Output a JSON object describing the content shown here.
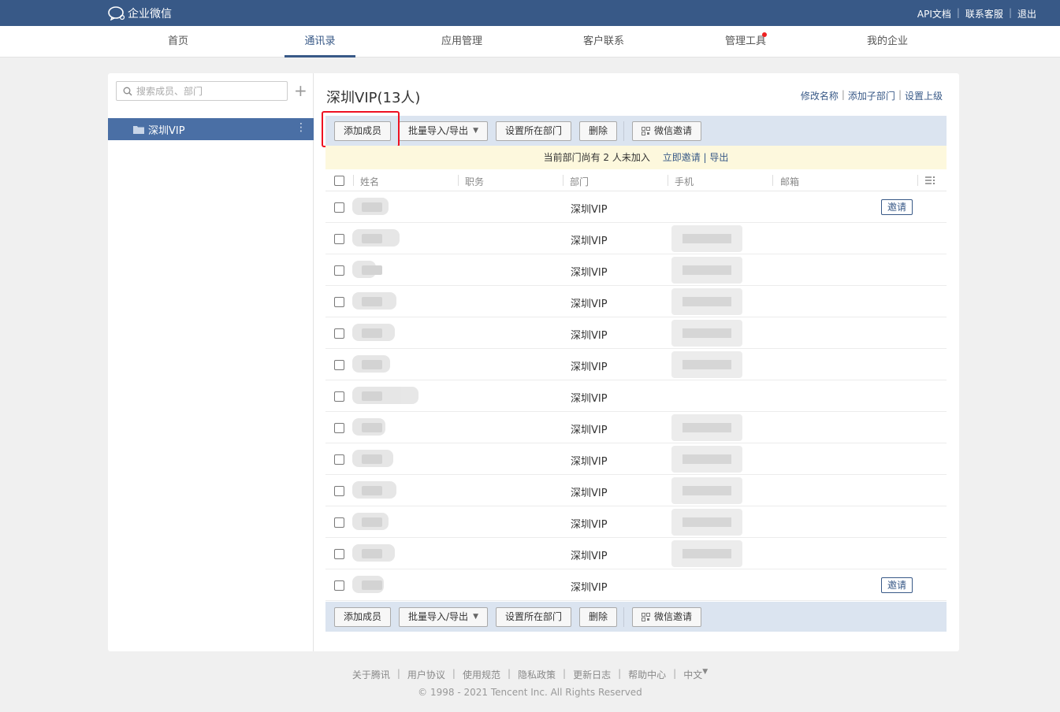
{
  "topbar": {
    "logo_text": "企业微信",
    "links": [
      "API文档",
      "联系客服",
      "退出"
    ]
  },
  "nav": {
    "items": [
      "首页",
      "通讯录",
      "应用管理",
      "客户联系",
      "管理工具",
      "我的企业"
    ],
    "active": "通讯录"
  },
  "sidebar": {
    "search_placeholder": "搜索成员、部门",
    "department": "深圳VIP"
  },
  "main": {
    "title": "深圳VIP(13人)",
    "title_links": [
      "修改名称",
      "添加子部门",
      "设置上级"
    ],
    "toolbar": {
      "add_member": "添加成员",
      "batch": "批量导入/导出",
      "set_dept": "设置所在部门",
      "delete": "删除",
      "wechat_invite": "微信邀请"
    },
    "notice": {
      "text": "当前部门尚有 2 人未加入",
      "invite": "立即邀请",
      "export": "导出"
    },
    "columns": [
      "姓名",
      "职务",
      "部门",
      "手机",
      "邮箱"
    ],
    "rows": [
      {
        "dept": "深圳VIP",
        "invite": "邀请"
      },
      {
        "dept": "深圳VIP"
      },
      {
        "dept": "深圳VIP"
      },
      {
        "dept": "深圳VIP"
      },
      {
        "dept": "深圳VIP"
      },
      {
        "dept": "深圳VIP"
      },
      {
        "dept": "深圳VIP"
      },
      {
        "dept": "深圳VIP"
      },
      {
        "dept": "深圳VIP"
      },
      {
        "dept": "深圳VIP"
      },
      {
        "dept": "深圳VIP"
      },
      {
        "dept": "深圳VIP"
      },
      {
        "dept": "深圳VIP",
        "invite": "邀请"
      }
    ]
  },
  "footer": {
    "links": [
      "关于腾讯",
      "用户协议",
      "使用规范",
      "隐私政策",
      "更新日志",
      "帮助中心",
      "中文"
    ],
    "copyright": "© 1998 - 2021 Tencent Inc. All Rights Reserved"
  }
}
